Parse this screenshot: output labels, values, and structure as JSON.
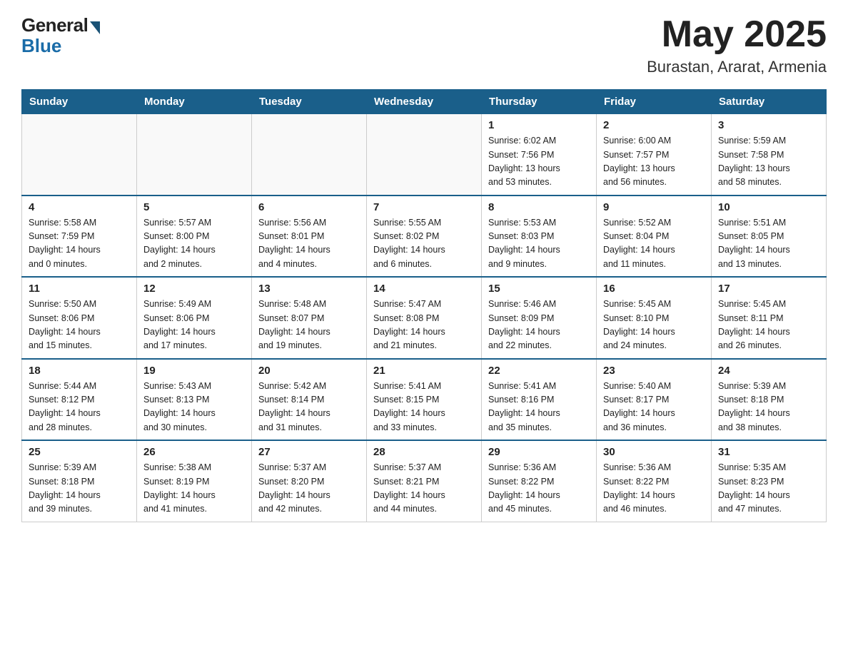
{
  "header": {
    "logo_general": "General",
    "logo_blue": "Blue",
    "month_title": "May 2025",
    "location": "Burastan, Ararat, Armenia"
  },
  "calendar": {
    "days_of_week": [
      "Sunday",
      "Monday",
      "Tuesday",
      "Wednesday",
      "Thursday",
      "Friday",
      "Saturday"
    ],
    "weeks": [
      [
        {
          "day": "",
          "info": ""
        },
        {
          "day": "",
          "info": ""
        },
        {
          "day": "",
          "info": ""
        },
        {
          "day": "",
          "info": ""
        },
        {
          "day": "1",
          "info": "Sunrise: 6:02 AM\nSunset: 7:56 PM\nDaylight: 13 hours\nand 53 minutes."
        },
        {
          "day": "2",
          "info": "Sunrise: 6:00 AM\nSunset: 7:57 PM\nDaylight: 13 hours\nand 56 minutes."
        },
        {
          "day": "3",
          "info": "Sunrise: 5:59 AM\nSunset: 7:58 PM\nDaylight: 13 hours\nand 58 minutes."
        }
      ],
      [
        {
          "day": "4",
          "info": "Sunrise: 5:58 AM\nSunset: 7:59 PM\nDaylight: 14 hours\nand 0 minutes."
        },
        {
          "day": "5",
          "info": "Sunrise: 5:57 AM\nSunset: 8:00 PM\nDaylight: 14 hours\nand 2 minutes."
        },
        {
          "day": "6",
          "info": "Sunrise: 5:56 AM\nSunset: 8:01 PM\nDaylight: 14 hours\nand 4 minutes."
        },
        {
          "day": "7",
          "info": "Sunrise: 5:55 AM\nSunset: 8:02 PM\nDaylight: 14 hours\nand 6 minutes."
        },
        {
          "day": "8",
          "info": "Sunrise: 5:53 AM\nSunset: 8:03 PM\nDaylight: 14 hours\nand 9 minutes."
        },
        {
          "day": "9",
          "info": "Sunrise: 5:52 AM\nSunset: 8:04 PM\nDaylight: 14 hours\nand 11 minutes."
        },
        {
          "day": "10",
          "info": "Sunrise: 5:51 AM\nSunset: 8:05 PM\nDaylight: 14 hours\nand 13 minutes."
        }
      ],
      [
        {
          "day": "11",
          "info": "Sunrise: 5:50 AM\nSunset: 8:06 PM\nDaylight: 14 hours\nand 15 minutes."
        },
        {
          "day": "12",
          "info": "Sunrise: 5:49 AM\nSunset: 8:06 PM\nDaylight: 14 hours\nand 17 minutes."
        },
        {
          "day": "13",
          "info": "Sunrise: 5:48 AM\nSunset: 8:07 PM\nDaylight: 14 hours\nand 19 minutes."
        },
        {
          "day": "14",
          "info": "Sunrise: 5:47 AM\nSunset: 8:08 PM\nDaylight: 14 hours\nand 21 minutes."
        },
        {
          "day": "15",
          "info": "Sunrise: 5:46 AM\nSunset: 8:09 PM\nDaylight: 14 hours\nand 22 minutes."
        },
        {
          "day": "16",
          "info": "Sunrise: 5:45 AM\nSunset: 8:10 PM\nDaylight: 14 hours\nand 24 minutes."
        },
        {
          "day": "17",
          "info": "Sunrise: 5:45 AM\nSunset: 8:11 PM\nDaylight: 14 hours\nand 26 minutes."
        }
      ],
      [
        {
          "day": "18",
          "info": "Sunrise: 5:44 AM\nSunset: 8:12 PM\nDaylight: 14 hours\nand 28 minutes."
        },
        {
          "day": "19",
          "info": "Sunrise: 5:43 AM\nSunset: 8:13 PM\nDaylight: 14 hours\nand 30 minutes."
        },
        {
          "day": "20",
          "info": "Sunrise: 5:42 AM\nSunset: 8:14 PM\nDaylight: 14 hours\nand 31 minutes."
        },
        {
          "day": "21",
          "info": "Sunrise: 5:41 AM\nSunset: 8:15 PM\nDaylight: 14 hours\nand 33 minutes."
        },
        {
          "day": "22",
          "info": "Sunrise: 5:41 AM\nSunset: 8:16 PM\nDaylight: 14 hours\nand 35 minutes."
        },
        {
          "day": "23",
          "info": "Sunrise: 5:40 AM\nSunset: 8:17 PM\nDaylight: 14 hours\nand 36 minutes."
        },
        {
          "day": "24",
          "info": "Sunrise: 5:39 AM\nSunset: 8:18 PM\nDaylight: 14 hours\nand 38 minutes."
        }
      ],
      [
        {
          "day": "25",
          "info": "Sunrise: 5:39 AM\nSunset: 8:18 PM\nDaylight: 14 hours\nand 39 minutes."
        },
        {
          "day": "26",
          "info": "Sunrise: 5:38 AM\nSunset: 8:19 PM\nDaylight: 14 hours\nand 41 minutes."
        },
        {
          "day": "27",
          "info": "Sunrise: 5:37 AM\nSunset: 8:20 PM\nDaylight: 14 hours\nand 42 minutes."
        },
        {
          "day": "28",
          "info": "Sunrise: 5:37 AM\nSunset: 8:21 PM\nDaylight: 14 hours\nand 44 minutes."
        },
        {
          "day": "29",
          "info": "Sunrise: 5:36 AM\nSunset: 8:22 PM\nDaylight: 14 hours\nand 45 minutes."
        },
        {
          "day": "30",
          "info": "Sunrise: 5:36 AM\nSunset: 8:22 PM\nDaylight: 14 hours\nand 46 minutes."
        },
        {
          "day": "31",
          "info": "Sunrise: 5:35 AM\nSunset: 8:23 PM\nDaylight: 14 hours\nand 47 minutes."
        }
      ]
    ]
  }
}
